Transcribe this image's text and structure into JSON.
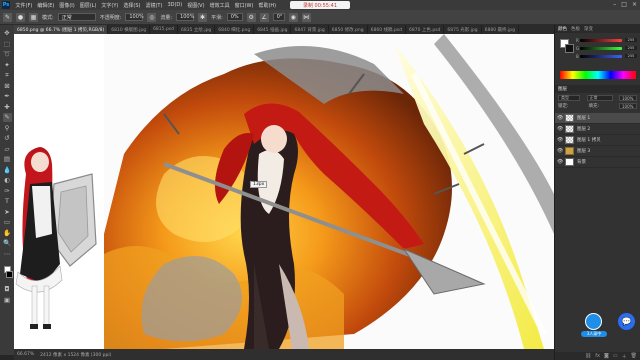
{
  "app": {
    "logo": "Ps",
    "record_badge": "录制 00:55:41"
  },
  "menu": [
    "文件(F)",
    "编辑(E)",
    "图像(I)",
    "图层(L)",
    "文字(Y)",
    "选择(S)",
    "滤镜(T)",
    "3D(D)",
    "视图(V)",
    "增效工具",
    "窗口(W)",
    "帮助(H)"
  ],
  "options": {
    "mode_label": "模式:",
    "mode_value": "正常",
    "opacity_label": "不透明度:",
    "opacity_value": "100%",
    "flow_label": "流量:",
    "flow_value": "100%",
    "smooth_label": "平滑:",
    "smooth_value": "0%",
    "angle_value": "0°"
  },
  "tabs": [
    "6850.png @ 66.7% (图层 1 拷贝,RGB/8)",
    "6810 横版图.jpg",
    "6815.psd",
    "6835 立绘.jpg",
    "6840 细化.png",
    "6845 插画.jpg",
    "6847 背景.jpg",
    "6850 修改.png",
    "6860 线稿.psd",
    "6870 上色.psd",
    "6875 光影.jpg",
    "6880 最终.jpg"
  ],
  "status": {
    "zoom": "66.67%",
    "doc_info": "2412 像素 x 1524 像素 (300 ppi)"
  },
  "zoom_tip": "13px",
  "panels": {
    "color_tabs": [
      "颜色",
      "色板",
      "渐变"
    ],
    "sliders": [
      {
        "label": "R",
        "value": "255",
        "color": "#ff4040"
      },
      {
        "label": "G",
        "value": "255",
        "color": "#40ff40"
      },
      {
        "label": "B",
        "value": "255",
        "color": "#4060ff"
      }
    ],
    "layers_header": "图层",
    "kind_label": "类型",
    "blend_value": "正常",
    "opacity_label": "不透明度:",
    "opacity_value": "100%",
    "lock_label": "锁定:",
    "fill_label": "填充:",
    "fill_value": "100%",
    "layers": [
      {
        "name": "图层 1",
        "selected": true,
        "type": "layer"
      },
      {
        "name": "图层 2",
        "selected": false,
        "type": "layer"
      },
      {
        "name": "图层 1 拷贝",
        "selected": false,
        "type": "layer"
      },
      {
        "name": "图层 3",
        "selected": false,
        "type": "folder"
      },
      {
        "name": "背景",
        "selected": false,
        "type": "white"
      }
    ]
  },
  "float": {
    "avatar_label": "3人录中"
  },
  "colors": {
    "accent": "#31a8ff",
    "panel": "#323232",
    "workspace": "#282828"
  }
}
